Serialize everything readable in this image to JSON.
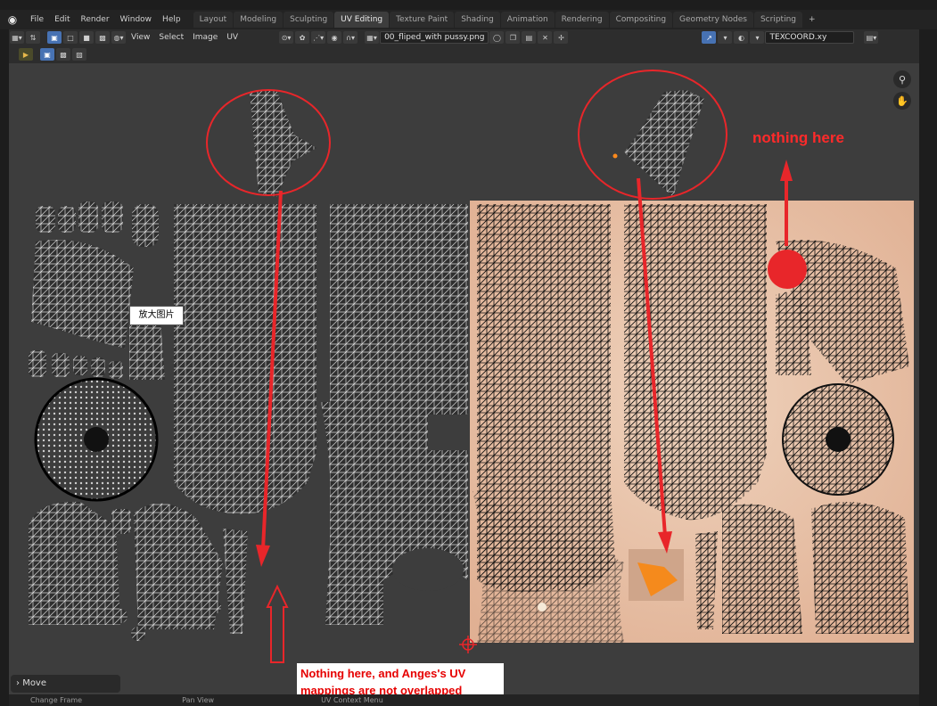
{
  "menu": {
    "file": "File",
    "edit": "Edit",
    "render": "Render",
    "window": "Window",
    "help": "Help"
  },
  "workspaces": [
    "Layout",
    "Modeling",
    "Sculpting",
    "UV Editing",
    "Texture Paint",
    "Shading",
    "Animation",
    "Rendering",
    "Compositing",
    "Geometry Nodes",
    "Scripting"
  ],
  "active_workspace": "UV Editing",
  "header": {
    "view": "View",
    "select": "Select",
    "image": "Image",
    "uv": "UV",
    "image_name": "00_fliped_with pussy.png",
    "uv_attribute": "TEXCOORD.xy"
  },
  "tooltip": "放大图片",
  "annotations": {
    "top_note": "nothing here",
    "bottom_note_line1": "Nothing here, and Anges's UV",
    "bottom_note_line2": "mappings are not overlapped"
  },
  "operator_panel": "Move",
  "status": {
    "item1": "Change Frame",
    "item2": "Pan View",
    "item3": "UV Context Menu"
  },
  "colors": {
    "annotation_red": "#e8262a",
    "active_tab": "#3d3d3d",
    "viewport_bg": "#3d3d3d",
    "texture_skin": "#eac4a8"
  },
  "icons": {
    "zoom": "zoom-icon",
    "pan": "hand-icon",
    "blender": "blender-logo-icon"
  }
}
